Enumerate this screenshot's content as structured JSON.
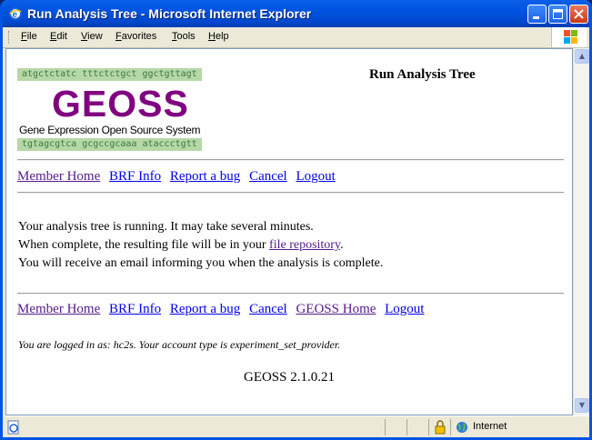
{
  "window": {
    "title": "Run Analysis Tree - Microsoft Internet Explorer"
  },
  "menu": [
    "File",
    "Edit",
    "View",
    "Favorites",
    "Tools",
    "Help"
  ],
  "logo": {
    "dna_top": "atgctctatc tttctctgct ggctgttagt",
    "word": "GEOSS",
    "subtitle": "Gene Expression Open Source System",
    "dna_bottom": "tgtagcgtca gcgccgcaaa ataccctgtt"
  },
  "page": {
    "title": "Run Analysis Tree",
    "nav_top": [
      "Member Home",
      "BRF Info",
      "Report a bug",
      "Cancel",
      "Logout"
    ],
    "message_line1": "Your analysis tree is running. It may take several minutes.",
    "message_line2_prefix": "When complete, the resulting file will be in your ",
    "message_line2_link": "file repository",
    "message_line2_suffix": ".",
    "message_line3": "You will receive an email informing you when the analysis is complete.",
    "nav_bottom": [
      "Member Home",
      "BRF Info",
      "Report a bug",
      "Cancel",
      "GEOSS Home",
      "Logout"
    ],
    "login_info": "You are logged in as: hc2s. Your account type is experiment_set_provider.",
    "version": "GEOSS 2.1.0.21"
  },
  "status": {
    "zone": "Internet"
  },
  "colors": {
    "visited": "#551a8b",
    "link": "#0000ee",
    "logo_purple": "#800080",
    "dna_green_bg": "#b6d7a8"
  }
}
